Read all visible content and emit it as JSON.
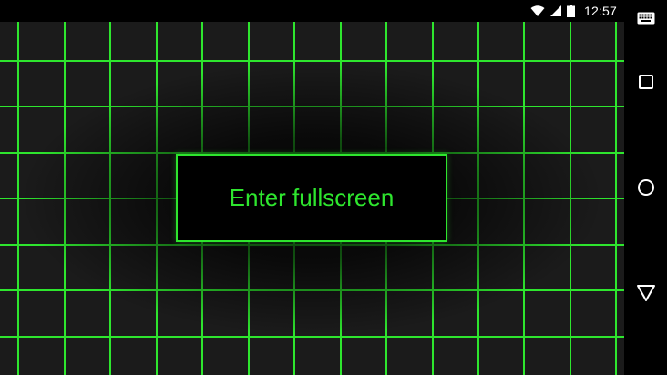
{
  "status_bar": {
    "time": "12:57",
    "icons": [
      "wifi-icon",
      "cell-signal-icon",
      "battery-icon"
    ]
  },
  "nav_bar": {
    "icons": [
      "keyboard-icon",
      "recents-icon",
      "home-icon",
      "back-icon"
    ]
  },
  "app": {
    "button_label": "Enter fullscreen"
  },
  "colors": {
    "grid_line": "#2ee62e",
    "background": "#1b1b1b",
    "button_bg": "#000000",
    "accent": "#2ee62e"
  }
}
